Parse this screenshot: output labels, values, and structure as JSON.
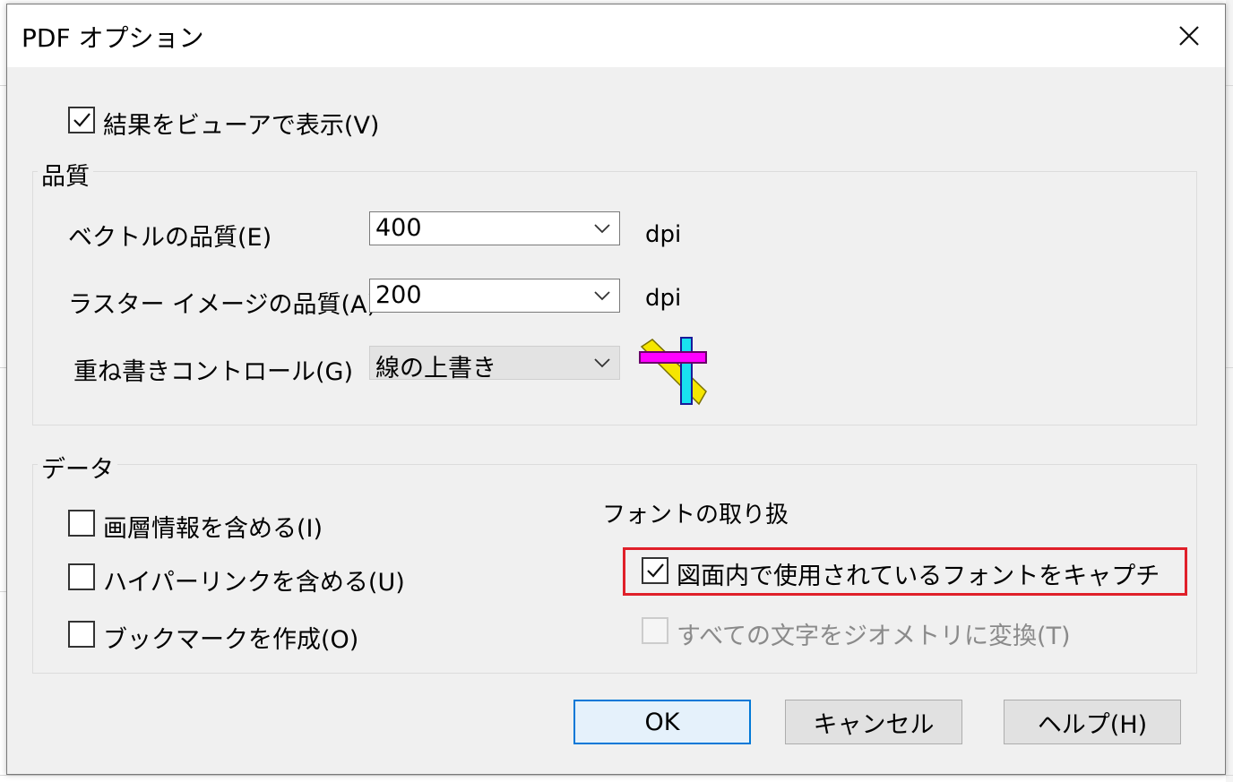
{
  "dialog": {
    "title": "PDF オプション",
    "close_label": "×"
  },
  "show_in_viewer": {
    "label": "結果をビューアで表示(V)",
    "checked": true
  },
  "quality_group": {
    "title": "品質",
    "vector": {
      "label": "ベクトルの品質(E)",
      "value": "400",
      "unit": "dpi"
    },
    "raster": {
      "label": "ラスター イメージの品質(A)",
      "value": "200",
      "unit": "dpi"
    },
    "overlay": {
      "label": "重ね書きコントロール(G)",
      "value": "線の上書き",
      "icon": "overwrite-lines-icon"
    }
  },
  "data_group": {
    "title": "データ",
    "include_layers": {
      "label": "画層情報を含める(I)",
      "checked": false
    },
    "include_hyperlinks": {
      "label": "ハイパーリンクを含める(U)",
      "checked": false
    },
    "create_bookmarks": {
      "label": "ブックマークを作成(O)",
      "checked": false
    },
    "font_handling": {
      "title": "フォントの取り扱",
      "capture_fonts": {
        "label": "図面内で使用されているフォントをキャプチャ(C",
        "checked": true
      },
      "convert_to_geometry": {
        "label": "すべての文字をジオメトリに変換(T)",
        "checked": false,
        "disabled": true
      }
    }
  },
  "buttons": {
    "ok": "OK",
    "cancel": "キャンセル",
    "help": "ヘルプ(H)"
  },
  "colors": {
    "highlight": "#e0202a",
    "accent": "#0078d7"
  }
}
